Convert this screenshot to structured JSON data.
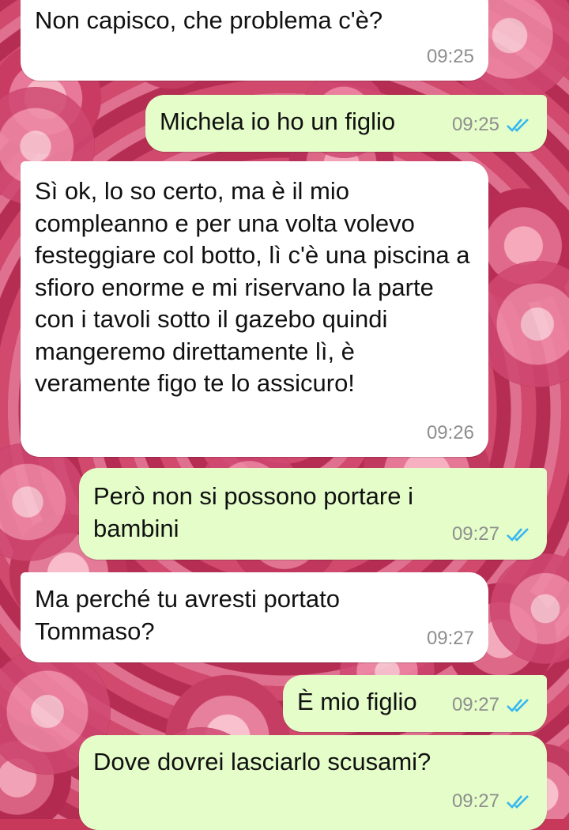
{
  "messages": [
    {
      "direction": "in",
      "text": "Non capisco, che problema c'è?",
      "time": "09:25"
    },
    {
      "direction": "out",
      "text": "Michela io ho un figlio",
      "time": "09:25",
      "status": "read"
    },
    {
      "direction": "in",
      "text": "Sì ok, lo so certo, ma è il mio compleanno e per una volta volevo festeggiare col botto, lì c'è una piscina a sfioro enorme e mi riservano la parte con i tavoli sotto il gazebo quindi mangeremo direttamente lì, è veramente figo te lo assicuro!",
      "time": "09:26"
    },
    {
      "direction": "out",
      "text": "Però non si possono portare i bambini",
      "time": "09:27",
      "status": "read"
    },
    {
      "direction": "in",
      "text": "Ma perché tu avresti portato Tommaso?",
      "time": "09:27"
    },
    {
      "direction": "out",
      "text": "È mio figlio",
      "time": "09:27",
      "status": "read"
    },
    {
      "direction": "out",
      "text": "Dove dovrei lasciarlo scusami?",
      "time": "09:27",
      "status": "read"
    }
  ],
  "colors": {
    "incoming_bubble": "#ffffff",
    "outgoing_bubble": "#e4fdc9",
    "read_tick": "#34b7f1",
    "timestamp": "#8e8e8e"
  },
  "icons": {
    "read_receipt": "double-check-icon"
  },
  "background": "pink-roses-wallpaper"
}
